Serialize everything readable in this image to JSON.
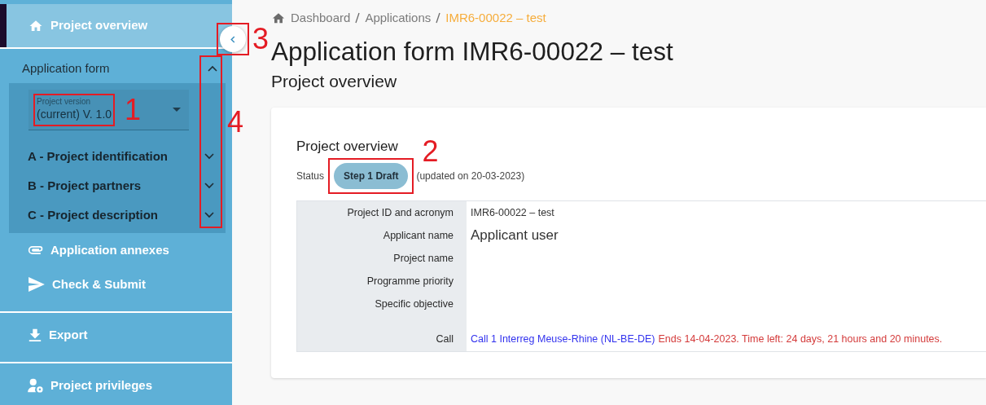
{
  "sidebar": {
    "groups": [
      [
        {
          "kind": "link",
          "label": "Project overview",
          "selected": true
        }
      ],
      [
        {
          "kind": "section",
          "label": "Application form",
          "expanded": true,
          "version_select": {
            "label": "Project version",
            "value": "(current) V. 1.0"
          },
          "items": [
            {
              "label": "A - Project identification",
              "expanded": false
            },
            {
              "label": "B - Project partners",
              "expanded": false
            },
            {
              "label": "C - Project description",
              "expanded": false
            }
          ]
        },
        {
          "kind": "link",
          "label": "Application annexes",
          "selected": false
        },
        {
          "kind": "link",
          "label": "Check & Submit",
          "selected": false
        }
      ],
      [
        {
          "kind": "link",
          "label": "Export",
          "selected": false
        }
      ],
      [
        {
          "kind": "link",
          "label": "Project privileges",
          "selected": false
        }
      ]
    ]
  },
  "breadcrumb": [
    {
      "label": "Dashboard",
      "current": false
    },
    {
      "label": "Applications",
      "current": false
    },
    {
      "label": "IMR6-00022 – test",
      "current": true
    }
  ],
  "title": "Application form IMR6-00022 – test",
  "subtitle": "Project overview",
  "card": {
    "title": "Project overview",
    "status_label": "Status",
    "status": "Step 1 Draft",
    "status_note": "(updated on 20-03-2023)",
    "rows": [
      {
        "kind": "text",
        "label": "Project ID and acronym",
        "value": "IMR6-00022 – test"
      },
      {
        "kind": "large",
        "label": "Applicant name",
        "value": "Applicant user"
      },
      {
        "kind": "text",
        "label": "Project name"
      },
      {
        "kind": "text",
        "label": "Programme priority"
      },
      {
        "kind": "text",
        "label": "Specific objective"
      },
      {
        "kind": "call",
        "label": "Call",
        "link": "Call 1 Interreg Meuse-Rhine (NL-BE-DE)",
        "note": "Ends 14-04-2023. Time left: 24 days, 21 hours and 20 minutes."
      }
    ]
  },
  "annotations": [
    {
      "label": "1"
    },
    {
      "label": "2"
    },
    {
      "label": "3"
    },
    {
      "label": "4"
    }
  ]
}
